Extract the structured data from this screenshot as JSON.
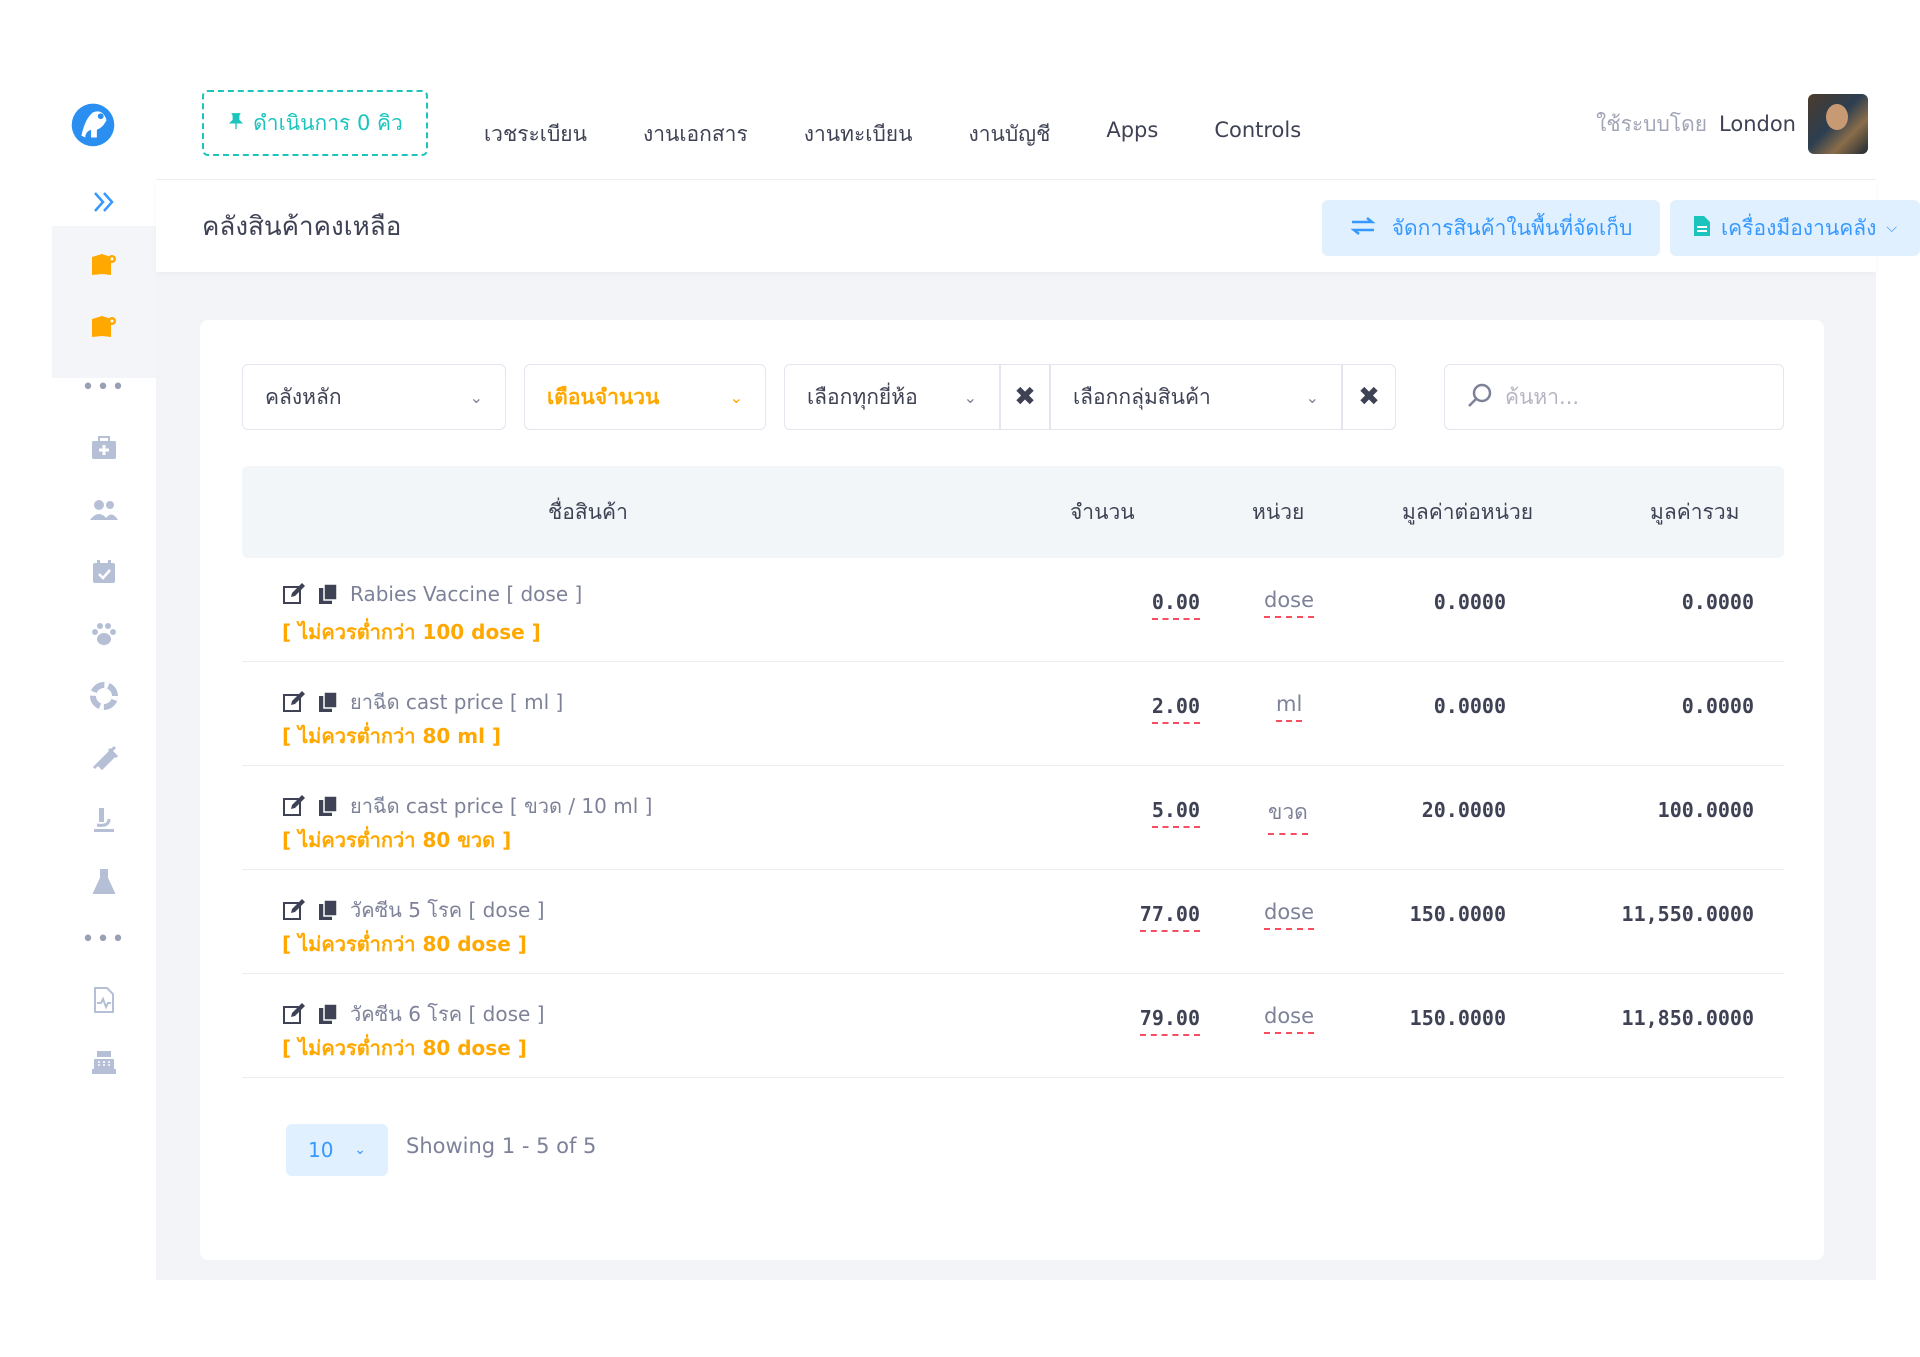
{
  "header": {
    "queue_button": "ดำเนินการ 0 คิว",
    "nav": [
      "เวชระเบียน",
      "งานเอกสาร",
      "งานทะเบียน",
      "งานบัญชี",
      "Apps",
      "Controls"
    ],
    "user_label": "ใช้ระบบโดย",
    "user_name": "London"
  },
  "subheader": {
    "title": "คลังสินค้าคงเหลือ",
    "manage_button": "จัดการสินค้าในพื้นที่จัดเก็บ",
    "tools_button": "เครื่องมืองานคลัง"
  },
  "filters": {
    "warehouse": "คลังหลัก",
    "alert": "เตือนจำนวน",
    "brand": "เลือกทุกยี่ห้อ",
    "group": "เลือกกลุ่มสินค้า",
    "search_placeholder": "ค้นหา..."
  },
  "table": {
    "headers": [
      "ชื่อสินค้า",
      "จำนวน",
      "หน่วย",
      "มูลค่าต่อหน่วย",
      "มูลค่ารวม"
    ],
    "rows": [
      {
        "name": "Rabies Vaccine [ dose ]",
        "warning": "[ ไม่ควรต่ำกว่า 100 dose ]",
        "qty": "0.00",
        "unit": "dose",
        "unit_value": "0.0000",
        "total": "0.0000"
      },
      {
        "name": "ยาฉีด cast price [ ml ]",
        "warning": "[ ไม่ควรต่ำกว่า 80 ml ]",
        "qty": "2.00",
        "unit": "ml",
        "unit_value": "0.0000",
        "total": "0.0000"
      },
      {
        "name": "ยาฉีด cast price [ ขวด / 10 ml ]",
        "warning": "[ ไม่ควรต่ำกว่า 80 ขวด ]",
        "qty": "5.00",
        "unit": "ขวด",
        "unit_value": "20.0000",
        "total": "100.0000"
      },
      {
        "name": "วัคซีน 5 โรค [ dose ]",
        "warning": "[ ไม่ควรต่ำกว่า 80 dose ]",
        "qty": "77.00",
        "unit": "dose",
        "unit_value": "150.0000",
        "total": "11,550.0000"
      },
      {
        "name": "วัคซีน 6 โรค [ dose ]",
        "warning": "[ ไม่ควรต่ำกว่า 80 dose ]",
        "qty": "79.00",
        "unit": "dose",
        "unit_value": "150.0000",
        "total": "11,850.0000"
      }
    ]
  },
  "pager": {
    "page_size": "10",
    "showing": "Showing 1 - 5 of 5"
  },
  "colors": {
    "primary": "#3699ff",
    "success": "#1bc5bd",
    "warning": "#ffa800",
    "danger": "#f64e60",
    "sidebar_icon": "#b5bfd6",
    "sidebar_active": "#ffa800"
  }
}
